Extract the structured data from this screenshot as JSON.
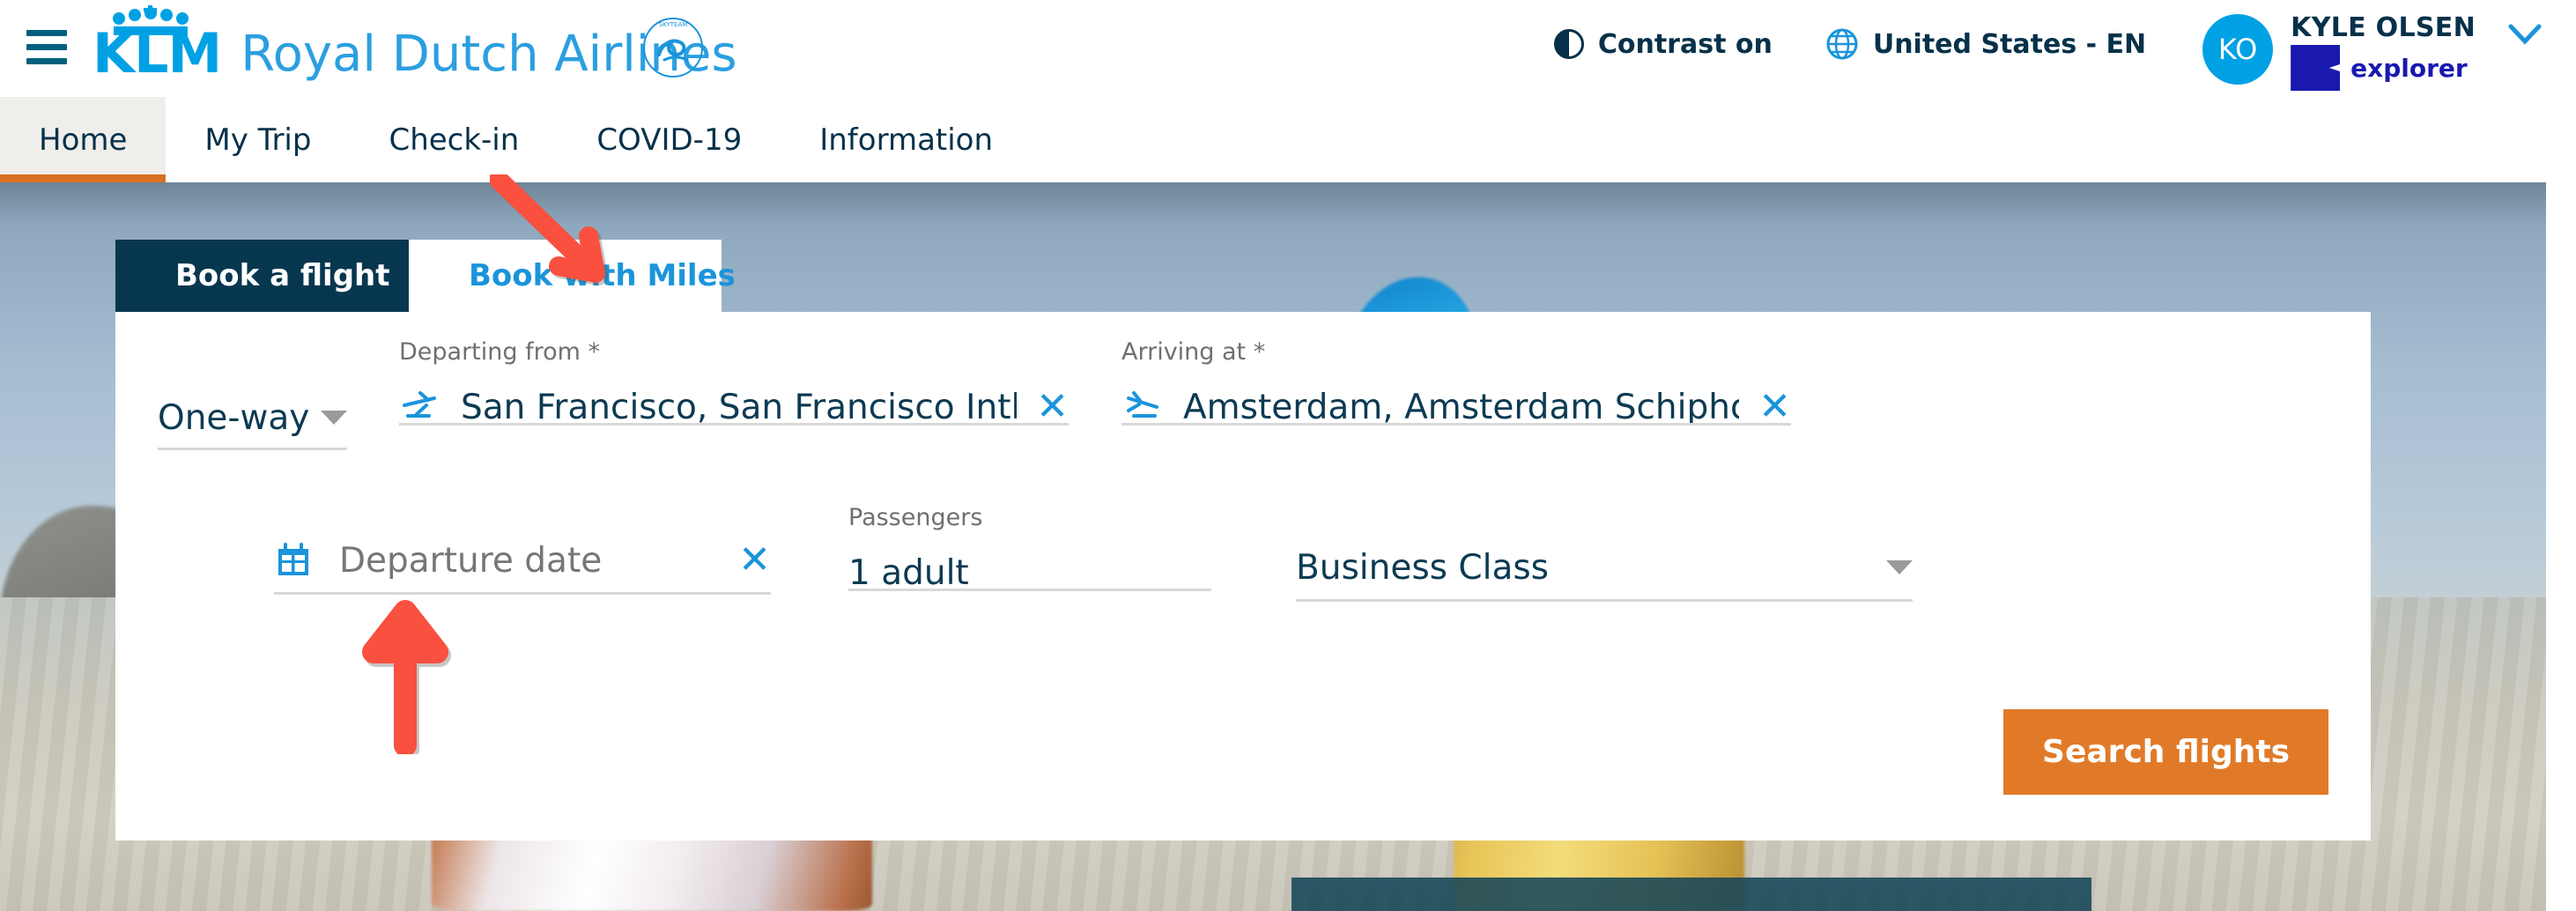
{
  "header": {
    "menu_icon": "hamburger-menu-icon",
    "brand_mark": "KLM",
    "brand_name": "Royal Dutch Airlines",
    "alliance_logo": "skyteam-logo",
    "contrast": {
      "icon": "contrast-icon",
      "label": "Contrast on"
    },
    "locale": {
      "icon": "globe-icon",
      "label": "United States - EN"
    },
    "user": {
      "initials": "KO",
      "name": "KYLE OLSEN",
      "tier": "explorer",
      "tier_badge_color": "#1919B0",
      "chevron": "chevron-down-icon"
    }
  },
  "nav": {
    "items": [
      {
        "label": "Home",
        "active": true
      },
      {
        "label": "My Trip",
        "active": false
      },
      {
        "label": "Check-in",
        "active": false
      },
      {
        "label": "COVID-19",
        "active": false
      },
      {
        "label": "Information",
        "active": false
      }
    ],
    "active_underline_color": "#D97024"
  },
  "booking": {
    "tabs": [
      {
        "label": "Book a flight",
        "icon": "airplane-icon",
        "active": true
      },
      {
        "label": "Book with Miles",
        "icon": "miles-coins-icon",
        "active": false
      }
    ],
    "trip_type": {
      "value": "One-way",
      "caret": "chevron-down-icon"
    },
    "departing": {
      "label": "Departing from *",
      "value": "San Francisco, San Francisco Intl.",
      "icon": "takeoff-plane-icon",
      "clear": "close-icon"
    },
    "arriving": {
      "label": "Arriving at *",
      "value": "Amsterdam, Amsterdam Schiphol Airp",
      "icon": "landing-plane-icon",
      "clear": "close-icon"
    },
    "departure_date": {
      "placeholder": "Departure date",
      "value": "",
      "icon": "calendar-icon",
      "clear": "close-icon"
    },
    "passengers": {
      "label": "Passengers",
      "value": "1 adult"
    },
    "cabin_class": {
      "value": "Business Class",
      "caret": "chevron-down-icon"
    },
    "search_button": {
      "label": "Search flights",
      "color": "#E17A28"
    }
  },
  "annotations": [
    {
      "name": "arrow-to-book-with-miles",
      "color": "#F9503F",
      "direction": "down-right"
    },
    {
      "name": "arrow-to-departure-date",
      "color": "#F9503F",
      "direction": "up"
    }
  ]
}
